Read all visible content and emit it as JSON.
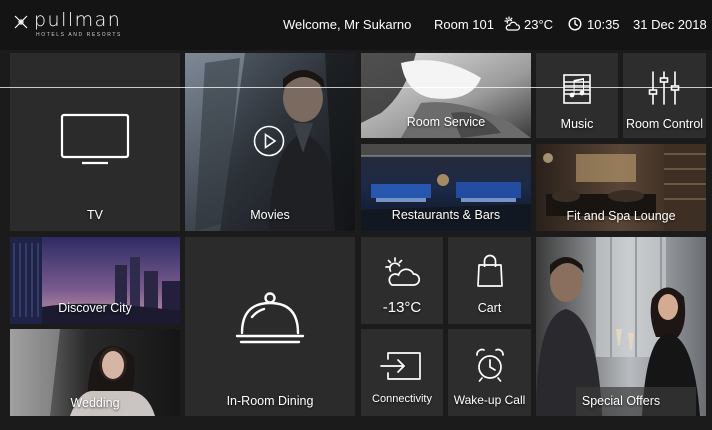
{
  "header": {
    "logo_text": "pullman",
    "logo_subtext": "HOTELS AND RESORTS",
    "welcome": "Welcome, Mr Sukarno",
    "room": "Room 101",
    "temperature": "23°C",
    "time": "10:35",
    "date": "31 Dec 2018",
    "weather_icon": "partly-cloudy-icon",
    "clock_icon": "clock-icon"
  },
  "tiles": {
    "tv": "TV",
    "movies": "Movies",
    "room_service": "Room Service",
    "music": "Music",
    "room_control": "Room Control",
    "restaurants": "Restaurants & Bars",
    "spa": "Fit and Spa Lounge",
    "discover": "Discover City",
    "wedding": "Wedding",
    "dining": "In-Room Dining",
    "weather": "-13°C",
    "cart": "Cart",
    "connectivity": "Connectivity",
    "wakeup": "Wake-up Call",
    "offers": "Special Offers"
  },
  "colors": {
    "background": "#1b1b1b",
    "header": "#141414",
    "tile": "#2c2c2c",
    "text": "#ffffff"
  }
}
